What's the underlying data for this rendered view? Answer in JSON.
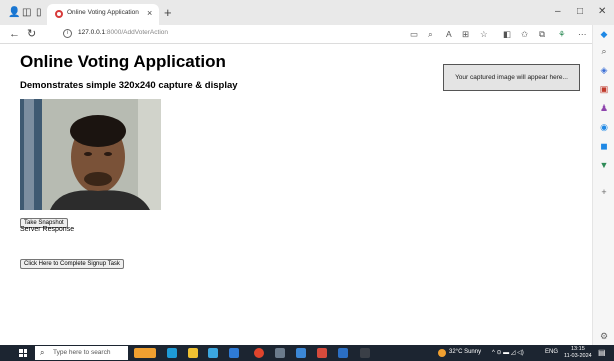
{
  "browser": {
    "tab_title": "Online Voting Application",
    "tab_close": "×",
    "new_tab": "+",
    "window_controls": {
      "minimize": "–",
      "maximize": "□",
      "close": "✕"
    },
    "address": {
      "host": "127.0.0.1",
      "path": ":8000/AddVoterAction"
    }
  },
  "page": {
    "title": "Online Voting Application",
    "subtitle": "Demonstrates simple 320x240 capture & display",
    "captured_placeholder": "Your captured image will appear here...",
    "snapshot_button": "Take Snapshot",
    "server_response": "Server Response",
    "signup_button": "Click Here to Complete Signup Task"
  },
  "taskbar": {
    "search_placeholder": "Type here to search",
    "weather": "32°C Sunny",
    "language": "ENG",
    "time": "13:15",
    "date": "11-03-2024"
  },
  "colors": {
    "accent_red": "#d83b3b",
    "taskbar_bg": "#1c2531",
    "captured_box_bg": "#e4e4e4"
  }
}
